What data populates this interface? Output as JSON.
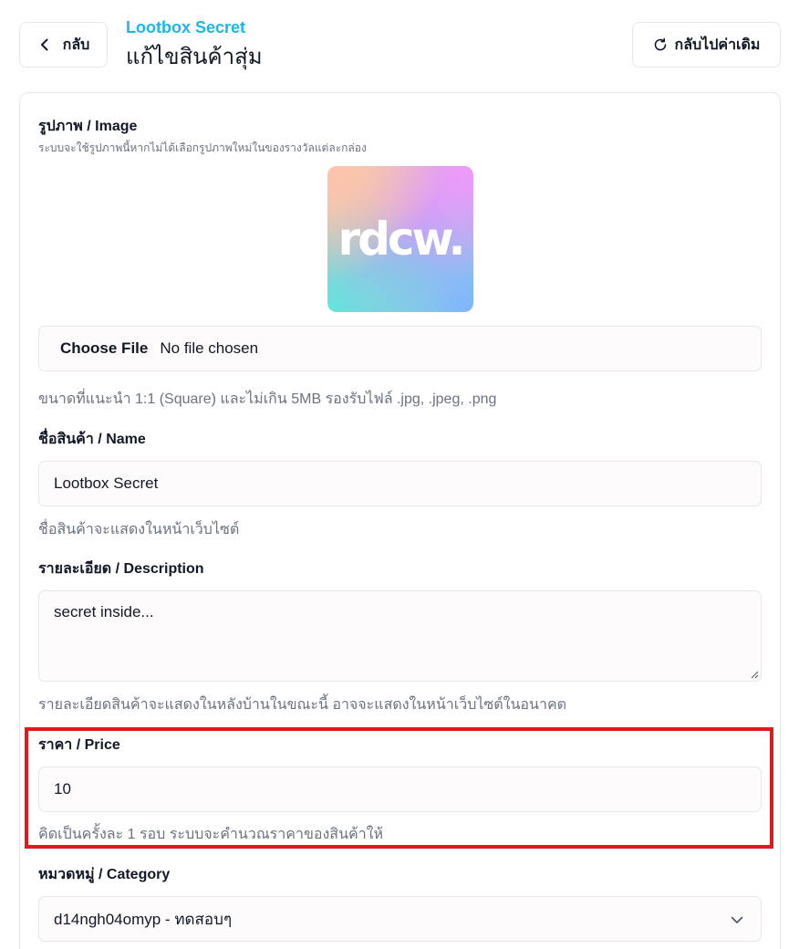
{
  "header": {
    "back_label": "กลับ",
    "subtitle": "Lootbox Secret",
    "title": "แก้ไขสินค้าสุ่ม",
    "reset_label": "กลับไปค่าเดิม"
  },
  "image_section": {
    "label": "รูปภาพ / Image",
    "hint": "ระบบจะใช้รูปภาพนี้หากไม่ได้เลือกรูปภาพใหม่ในของรางวัลแต่ละกล่อง",
    "preview_logo_text": "rdcw.",
    "file_button": "Choose File",
    "file_status": "No file chosen",
    "size_hint": "ขนาดที่แนะนำ 1:1 (Square) และไม่เกิน 5MB รองรับไฟล์ .jpg, .jpeg, .png"
  },
  "name_section": {
    "label": "ชื่อสินค้า / Name",
    "value": "Lootbox Secret",
    "hint": "ชื่อสินค้าจะแสดงในหน้าเว็บไซต์"
  },
  "description_section": {
    "label": "รายละเอียด / Description",
    "value": "secret inside...",
    "hint": "รายละเอียดสินค้าจะแสดงในหลังบ้านในขณะนี้ อาจจะแสดงในหน้าเว็บไซต์ในอนาคต"
  },
  "price_section": {
    "label": "ราคา / Price",
    "value": "10",
    "hint": "คิดเป็นครั้งละ 1 รอบ ระบบจะคำนวณราคาของสินค้าให้",
    "highlight_color": "#e0191b"
  },
  "category_section": {
    "label": "หมวดหมู่ / Category",
    "selected": "d14ngh04omyp - ทดสอบๆ"
  },
  "colors": {
    "accent": "#1ab8e6",
    "highlight": "#e0191b"
  },
  "icons": {
    "back": "chevron-left-icon",
    "reset": "refresh-icon",
    "select": "chevron-down-icon"
  }
}
